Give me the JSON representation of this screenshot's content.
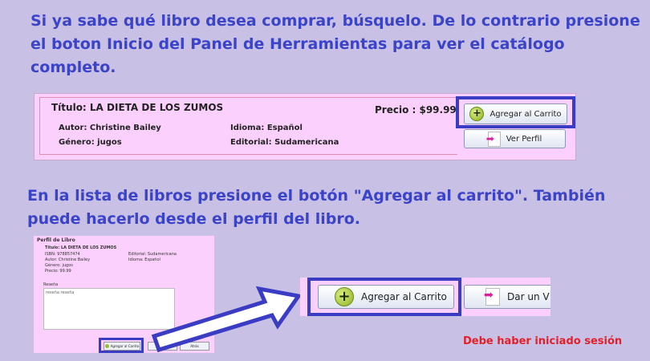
{
  "instructions": {
    "step1": "Si ya sabe qué libro desea comprar, búsquelo. De lo contrario presione el boton Inicio del Panel de Herramientas para ver el catálogo completo.",
    "step2": "En la lista de libros presione el botón \"Agregar al carrito\". También puede hacerlo desde el perfil del libro.",
    "warning": "Debe haber iniciado sesión"
  },
  "book_card": {
    "title": "Título: LA DIETA DE LOS ZUMOS",
    "author": "Autor: Christine Bailey",
    "language": "Idioma: Español",
    "genre": "Género: jugos",
    "publisher": "Editorial: Sudamericana",
    "price": "Precio : $99.99",
    "add_to_cart_label": "Agregar al Carrito",
    "view_profile_label": "Ver Perfil"
  },
  "profile_thumb": {
    "header": "Perfil de Libro",
    "title": "Título: LA DIETA DE LOS ZUMOS",
    "isbn": "ISBN: 978857474",
    "publisher": "Editorial: Sudamericana",
    "author": "Autor: Christine Bailey",
    "language": "Idioma: Español",
    "genre": "Género: jugos",
    "price": "Precio: 99.99",
    "review_label": "Reseña",
    "review_text": "reseña reseña",
    "add_label": "Agregar al Carrito",
    "btn2_label": "",
    "back_label": "Atrás"
  },
  "zoomed": {
    "add_label": "Agregar al Carrito",
    "other_label": "Dar un V"
  },
  "colors": {
    "background": "#c9c0e6",
    "headline": "#3b43c9",
    "card": "#fcd0fc",
    "highlight": "#3a3cc4",
    "warning": "#e3202a"
  },
  "icons": {
    "add": "plus-circle-icon",
    "profile": "document-arrow-icon",
    "pointer": "arrow-right-icon"
  }
}
